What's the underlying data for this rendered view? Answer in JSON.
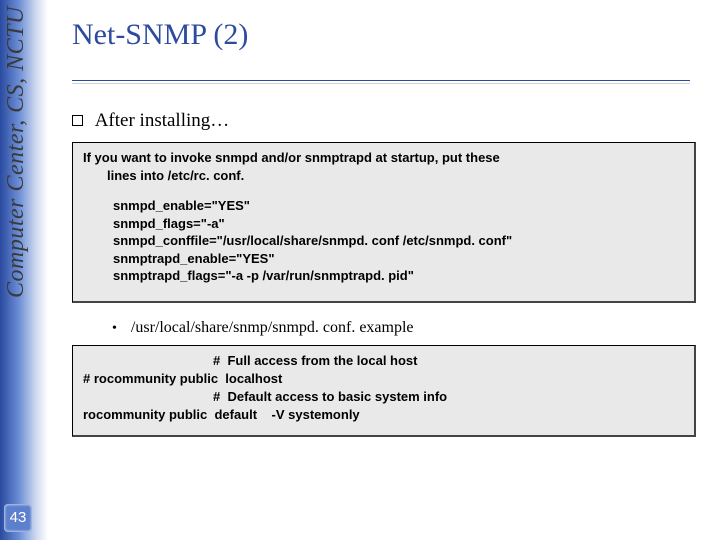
{
  "sidebar": {
    "org_text": "Computer Center, CS, NCTU",
    "page_number": "43"
  },
  "title": "Net-SNMP (2)",
  "content": {
    "bullet1": "After installing…",
    "note_line1": "If you want to invoke snmpd and/or snmptrapd at startup, put these",
    "note_line2": "lines into /etc/rc. conf.",
    "code": {
      "l1": "snmpd_enable=\"YES\"",
      "l2": "snmpd_flags=\"-a\"",
      "l3": "snmpd_conffile=\"/usr/local/share/snmpd. conf /etc/snmpd. conf\"",
      "l4": "snmptrapd_enable=\"YES\"",
      "l5": "snmptrapd_flags=\"-a -p /var/run/snmptrapd. pid\""
    },
    "sub_bullet": "/usr/local/share/snmp/snmpd. conf. example",
    "conf_block": "                                    #  Full access from the local host\n# rocommunity public  localhost\n                                    #  Default access to basic system info\nrocommunity public  default    -V systemonly"
  }
}
